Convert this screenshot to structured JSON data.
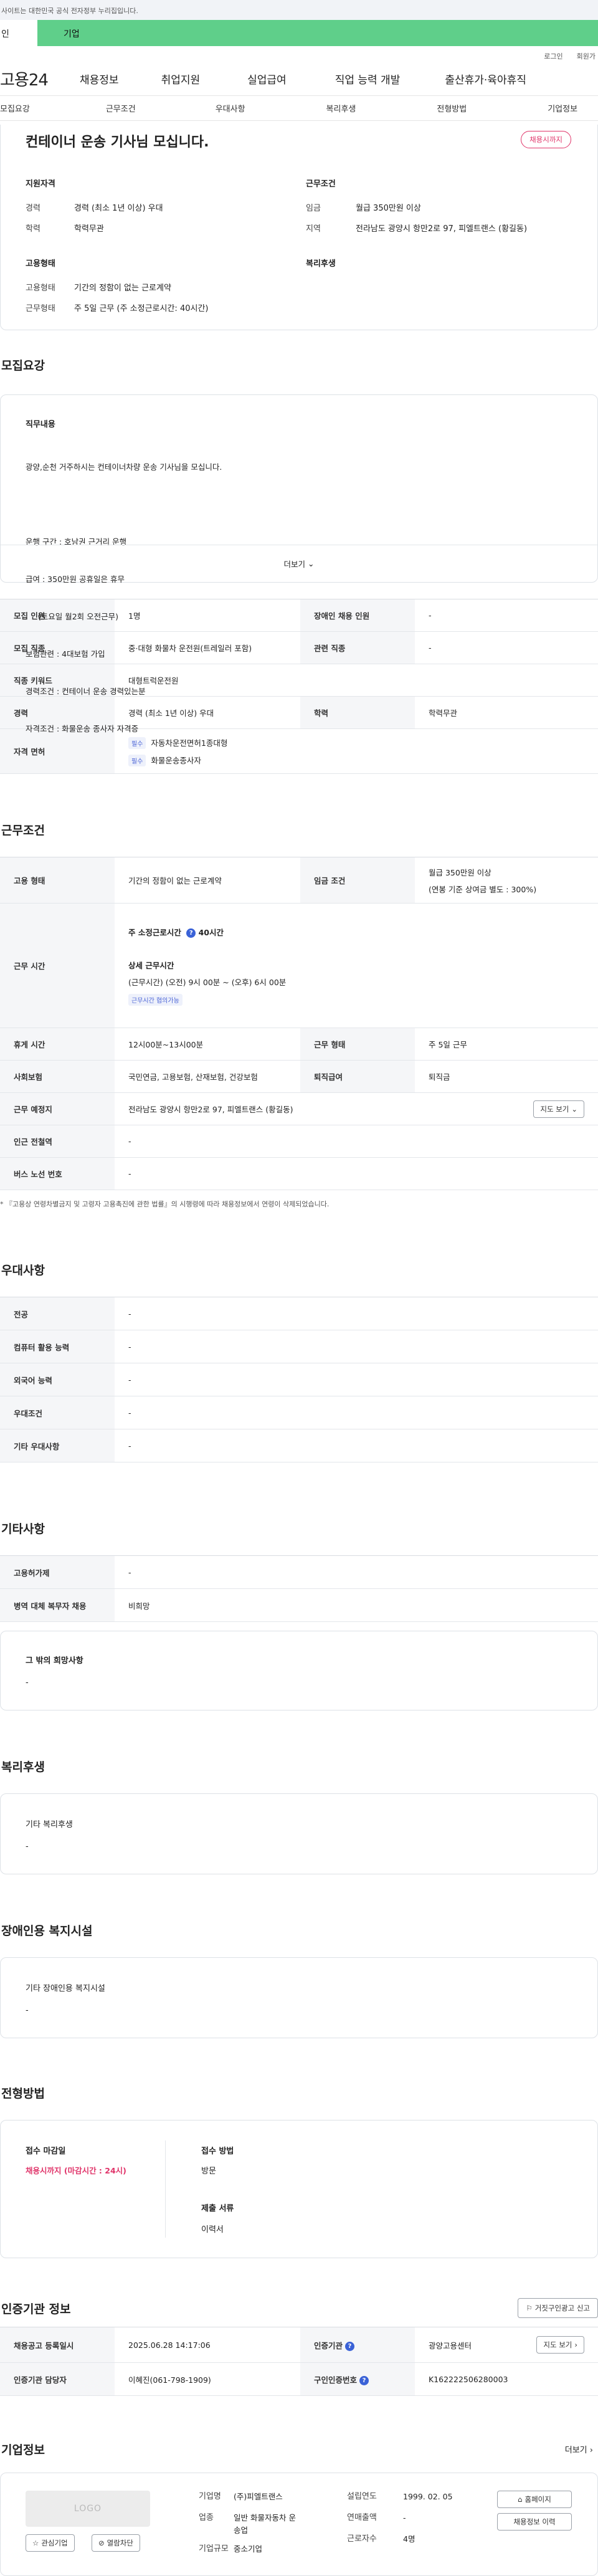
{
  "gov_banner": {
    "text": "사이트는 대한민국 공식 전자정부 누리집입니다."
  },
  "user_tabs": {
    "personal": "인",
    "company": "기업"
  },
  "util": {
    "login": "로그인",
    "signup": "회원가"
  },
  "gnb": {
    "logo": "고용24",
    "items": [
      "채용정보",
      "취업지원",
      "실업급여",
      "직업 능력 개발",
      "출산휴가·육아휴직"
    ]
  },
  "snb": {
    "items": [
      "모집요강",
      "근무조건",
      "우대사항",
      "복리후생",
      "전형방법",
      "기업정보"
    ]
  },
  "summary": {
    "title": "컨테이너 운송 기사님 모십니다.",
    "status_badge": "채용시까지",
    "qual": {
      "heading": "지원자격",
      "exp_label": "경력",
      "exp_value": "경력 (최소 1년 이상) 우대",
      "edu_label": "학력",
      "edu_value": "학력무관"
    },
    "cond": {
      "heading": "근무조건",
      "wage_label": "임금",
      "wage_value": "월급 350만원 이상",
      "loc_label": "지역",
      "loc_value": "전라남도 광양시 항만2로 97, 피엘트랜스 (황길동)"
    },
    "emp": {
      "heading": "고용형태",
      "type_label": "고용형태",
      "type_value": "기간의 정함이 없는 근로계약",
      "work_label": "근무형태",
      "work_value": "주 5일 근무 (주 소정근로시간: 40시간)"
    },
    "welfare": {
      "heading": "복리후생"
    }
  },
  "recruit": {
    "title": "모집요강",
    "duty_heading": "직무내용",
    "duty_lines": [
      "광양,순천 거주하시는 컨테이너차량 운송 기사님을 모십니다.",
      "",
      "운행 구간 : 호남권 근거리 운행",
      "급여 : 350만원 공휴일은 휴무",
      "     (토요일 월2회 오전근무)",
      "보험관련 : 4대보험 가입",
      "경력조건 : 컨테이너 운송 경력있는분",
      "자격조건 : 화물운송 종사자 자격증"
    ],
    "more": "더보기",
    "rows": {
      "count_label": "모집 인원",
      "count_value": "1명",
      "disabled_label": "장애인 채용 인원",
      "disabled_value": "-",
      "job_label": "모집 직종",
      "job_value": "중·대형 화물차 운전원(트레일러 포함)",
      "related_label": "관련 직종",
      "related_value": "-",
      "keyword_label": "직종 키워드",
      "keyword_value": "대형트럭운전원",
      "career_label": "경력",
      "career_value": "경력 (최소 1년 이상) 우대",
      "edu_label": "학력",
      "edu_value": "학력무관",
      "license_label": "자격 면허",
      "licenses": [
        {
          "tag": "필수",
          "name": "자동차운전면허1종대형"
        },
        {
          "tag": "필수",
          "name": "화물운송종사자"
        }
      ]
    }
  },
  "conditions": {
    "title": "근무조건",
    "emp_label": "고용 형태",
    "emp_value": "기간의 정함이 없는 근로계약",
    "wage_label": "임금 조건",
    "wage_value": "월급 350만원 이상",
    "wage_sub": "(연봉 기준 상여금 별도 : 300%)",
    "time_label": "근무 시간",
    "weekly_label": "주 소정근로시간",
    "weekly_value": "40시간",
    "detail_label": "상세 근무시간",
    "detail_value": "(근무시간) (오전) 9시 00분 ~ (오후) 6시 00분",
    "negotiable": "근무시간 협의가능",
    "rest_label": "휴게 시간",
    "rest_value": "12시00분~13시00분",
    "shape_label": "근무 형태",
    "shape_value": "주 5일 근무",
    "insurance_label": "사회보험",
    "insurance_value": "국민연금, 고용보험, 산재보험, 건강보험",
    "retire_label": "퇴직급여",
    "retire_value": "퇴직금",
    "place_label": "근무 예정지",
    "place_value": "전라남도 광양시 항만2로 97, 피엘트랜스 (황길동)",
    "map_button": "지도 보기",
    "station_label": "인근 전철역",
    "station_value": "-",
    "bus_label": "버스 노선 번호",
    "bus_value": "-",
    "note": "* 『고용상 연령차별금지 및 고령자 고용촉진에 관한 법률』의 시행령에 따라 채용정보에서 연령이 삭제되었습니다."
  },
  "prefer": {
    "title": "우대사항",
    "rows": [
      {
        "label": "전공",
        "value": "-"
      },
      {
        "label": "컴퓨터 활용 능력",
        "value": "-"
      },
      {
        "label": "외국어 능력",
        "value": "-"
      },
      {
        "label": "우대조건",
        "value": "-"
      },
      {
        "label": "기타 우대사항",
        "value": "-"
      }
    ]
  },
  "etc": {
    "title": "기타사항",
    "rows": [
      {
        "label": "고용허가제",
        "value": "-"
      },
      {
        "label": "병역 대체 복무자 채용",
        "value": "비희망"
      }
    ],
    "wish_heading": "그 밖의 희망사항",
    "wish_value": "-"
  },
  "welfare": {
    "title": "복리후생",
    "heading": "기타 복리후생",
    "value": "-"
  },
  "facility": {
    "title": "장애인용 복지시설",
    "heading": "기타 장애인용 복지시설",
    "value": "-"
  },
  "process": {
    "title": "전형방법",
    "deadline_heading": "접수 마감일",
    "deadline_value": "채용시까지 (마감시간 : 24시)",
    "method_heading": "접수 방법",
    "method_value": "방문",
    "docs_heading": "제출 서류",
    "docs_value": "이력서"
  },
  "agency": {
    "title": "인증기관 정보",
    "report_button": "거짓구인광고 신고",
    "reg_label": "채용공고 등록일시",
    "reg_value": "2025.06.28 14:17:06",
    "org_label": "인증기관",
    "org_value": "광양고용센터",
    "map_button": "지도 보기",
    "mgr_label": "인증기관 담당자",
    "mgr_value": "이혜진(061-798-1909)",
    "cert_label": "구인인증번호",
    "cert_value": "K162222506280003"
  },
  "company": {
    "title": "기업정보",
    "more": "더보기",
    "logo_text": "LOGO",
    "interest_button": "관심기업",
    "block_button": "열람차단",
    "name_label": "기업명",
    "name_value": "(주)피엘트랜스",
    "industry_label": "업종",
    "industry_value": "일반 화물자동차 운송업",
    "size_label": "기업규모",
    "size_value": "중소기업",
    "founded_label": "설립연도",
    "founded_value": "1999. 02. 05",
    "sales_label": "연매출액",
    "sales_value": "-",
    "employees_label": "근로자수",
    "employees_value": "4명",
    "homepage_button": "홈페이지",
    "history_button": "채용정보 이력"
  }
}
